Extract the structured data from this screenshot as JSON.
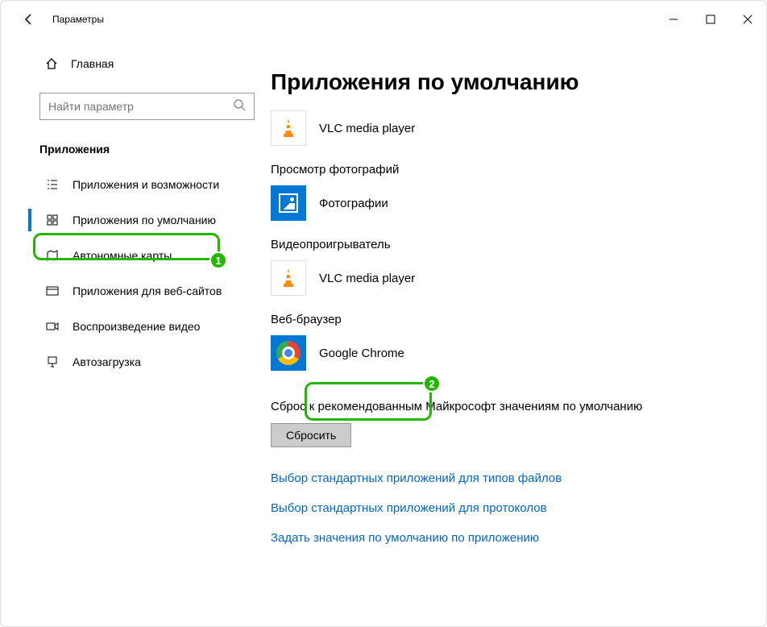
{
  "window": {
    "title": "Параметры"
  },
  "sidebar": {
    "home": "Главная",
    "search_placeholder": "Найти параметр",
    "section": "Приложения",
    "items": [
      {
        "label": "Приложения и возможности"
      },
      {
        "label": "Приложения по умолчанию"
      },
      {
        "label": "Автономные карты"
      },
      {
        "label": "Приложения для веб-сайтов"
      },
      {
        "label": "Воспроизведение видео"
      },
      {
        "label": "Автозагрузка"
      }
    ]
  },
  "main": {
    "title": "Приложения по умолчанию",
    "defaults": [
      {
        "category": "",
        "app": "VLC media player",
        "icon": "vlc"
      },
      {
        "category": "Просмотр фотографий",
        "app": "Фотографии",
        "icon": "photos"
      },
      {
        "category": "Видеопроигрыватель",
        "app": "VLC media player",
        "icon": "vlc"
      },
      {
        "category": "Веб-браузер",
        "app": "Google Chrome",
        "icon": "chrome"
      }
    ],
    "reset_text": "Сброс к рекомендованным Майкрософт значениям по умолчанию",
    "reset_button": "Сбросить",
    "links": [
      "Выбор стандартных приложений для типов файлов",
      "Выбор стандартных приложений для протоколов",
      "Задать значения по умолчанию по приложению"
    ]
  },
  "annotations": {
    "n1": "1",
    "n2": "2"
  }
}
